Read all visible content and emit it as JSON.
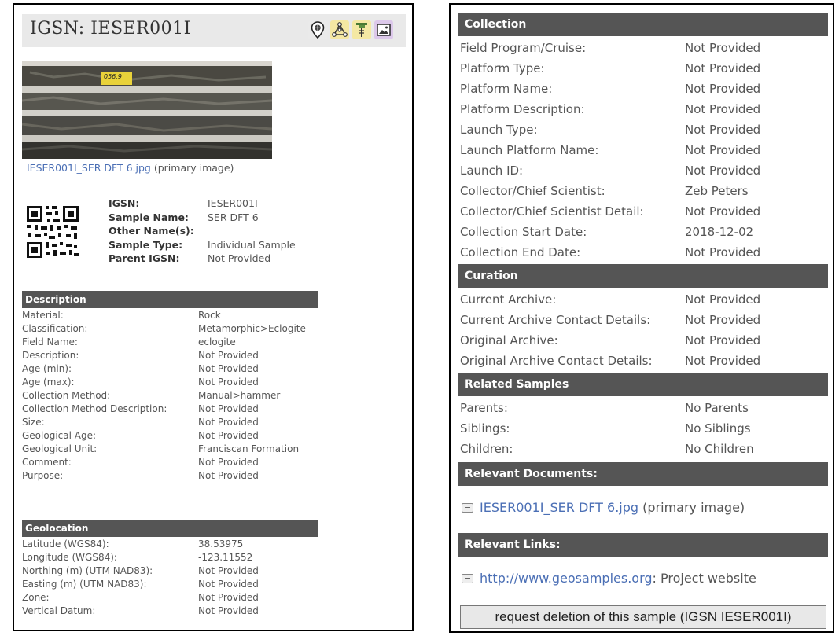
{
  "sample_title": "IGSN: IESER001I",
  "toolbar_icons": [
    "map-pin-icon",
    "molecule-icon",
    "drill-icon",
    "gallery-icon"
  ],
  "colors": {
    "section_header": "#555555",
    "link": "#4b6fb5",
    "title_bar": "#e9e9e9",
    "pin_icon_bg": "#eaeaea",
    "molecule_icon_bg": "#f4e8a3",
    "drill_icon_bg": "#f4e8a3",
    "gallery_icon_bg": "#dcc8ea"
  },
  "image": {
    "filename": "IESER001I_SER DFT 6.jpg",
    "caption_suffix": " (primary image)",
    "label_text": "056.9"
  },
  "summary": [
    {
      "label": "IGSN:",
      "value": "IESER001I"
    },
    {
      "label": "Sample Name:",
      "value": "SER DFT 6"
    },
    {
      "label": "Other Name(s):",
      "value": ""
    },
    {
      "label": "Sample Type:",
      "value": "Individual Sample"
    },
    {
      "label": "Parent IGSN:",
      "value": "Not Provided"
    }
  ],
  "description": {
    "header": "Description",
    "rows": [
      {
        "label": "Material:",
        "value": "Rock"
      },
      {
        "label": "Classification:",
        "value": "Metamorphic>Eclogite"
      },
      {
        "label": "Field Name:",
        "value": "eclogite"
      },
      {
        "label": "Description:",
        "value": "Not Provided"
      },
      {
        "label": "Age (min):",
        "value": "Not Provided"
      },
      {
        "label": "Age (max):",
        "value": "Not Provided"
      },
      {
        "label": "Collection Method:",
        "value": "Manual>hammer"
      },
      {
        "label": "Collection Method Description:",
        "value": "Not Provided"
      },
      {
        "label": "Size:",
        "value": "Not Provided"
      },
      {
        "label": "Geological Age:",
        "value": "Not Provided"
      },
      {
        "label": "Geological Unit:",
        "value": "Franciscan Formation"
      },
      {
        "label": "Comment:",
        "value": "Not Provided"
      },
      {
        "label": "Purpose:",
        "value": "Not Provided"
      }
    ]
  },
  "geolocation": {
    "header": "Geolocation",
    "rows": [
      {
        "label": "Latitude (WGS84):",
        "value": "38.53975"
      },
      {
        "label": "Longitude (WGS84):",
        "value": "-123.11552"
      },
      {
        "label": "Northing (m) (UTM NAD83):",
        "value": "Not Provided"
      },
      {
        "label": "Easting (m) (UTM NAD83):",
        "value": "Not Provided"
      },
      {
        "label": "Zone:",
        "value": "Not Provided"
      },
      {
        "label": "Vertical Datum:",
        "value": "Not Provided"
      }
    ]
  },
  "collection": {
    "header": "Collection",
    "rows": [
      {
        "label": "Field Program/Cruise:",
        "value": "Not Provided"
      },
      {
        "label": "Platform Type:",
        "value": "Not Provided"
      },
      {
        "label": "Platform Name:",
        "value": "Not Provided"
      },
      {
        "label": "Platform Description:",
        "value": "Not Provided"
      },
      {
        "label": "Launch Type:",
        "value": "Not Provided"
      },
      {
        "label": "Launch Platform Name:",
        "value": "Not Provided"
      },
      {
        "label": "Launch ID:",
        "value": "Not Provided"
      },
      {
        "label": "Collector/Chief Scientist:",
        "value": "Zeb Peters"
      },
      {
        "label": "Collector/Chief Scientist Detail:",
        "value": "Not Provided"
      },
      {
        "label": "Collection Start Date:",
        "value": "2018-12-02"
      },
      {
        "label": "Collection End Date:",
        "value": "Not Provided"
      }
    ]
  },
  "curation": {
    "header": "Curation",
    "rows": [
      {
        "label": "Current Archive:",
        "value": "Not Provided"
      },
      {
        "label": "Current Archive Contact Details:",
        "value": "Not Provided"
      },
      {
        "label": "Original Archive:",
        "value": "Not Provided"
      },
      {
        "label": "Original Archive Contact Details:",
        "value": "Not Provided"
      }
    ]
  },
  "related_samples": {
    "header": "Related Samples",
    "rows": [
      {
        "label": "Parents:",
        "value": "No Parents"
      },
      {
        "label": "Siblings:",
        "value": "No Siblings"
      },
      {
        "label": "Children:",
        "value": "No Children"
      }
    ]
  },
  "relevant_documents": {
    "header": "Relevant Documents:",
    "link_text": "IESER001I_SER DFT 6.jpg",
    "suffix": " (primary image)"
  },
  "relevant_links": {
    "header": "Relevant Links:",
    "link_text": "http://www.geosamples.org",
    "suffix": ": Project website"
  },
  "request_deletion_label": "request deletion of this sample (IGSN IESER001I)"
}
